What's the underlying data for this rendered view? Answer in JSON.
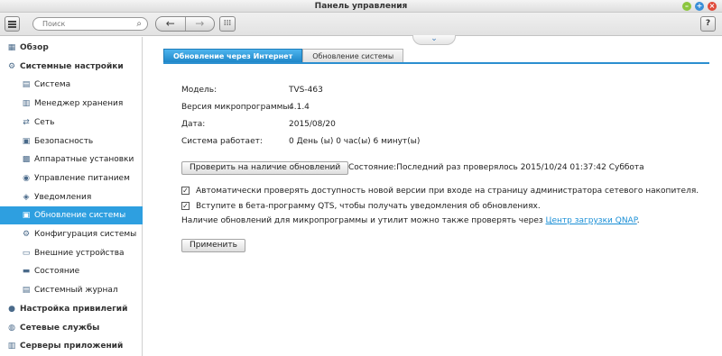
{
  "window": {
    "title": "Панель управления"
  },
  "toolbar": {
    "search_placeholder": "Поиск",
    "help_label": "?"
  },
  "sidebar": {
    "items": [
      {
        "label": "Обзор",
        "kind": "cat",
        "icon": "overview-icon"
      },
      {
        "label": "Системные настройки",
        "kind": "cat",
        "icon": "gear-icon"
      },
      {
        "label": "Система",
        "kind": "sub",
        "icon": "system-icon"
      },
      {
        "label": "Менеджер хранения",
        "kind": "sub",
        "icon": "storage-icon"
      },
      {
        "label": "Сеть",
        "kind": "sub",
        "icon": "network-icon"
      },
      {
        "label": "Безопасность",
        "kind": "sub",
        "icon": "lock-icon"
      },
      {
        "label": "Аппаратные установки",
        "kind": "sub",
        "icon": "hardware-icon"
      },
      {
        "label": "Управление питанием",
        "kind": "sub",
        "icon": "power-icon"
      },
      {
        "label": "Уведомления",
        "kind": "sub",
        "icon": "notification-icon"
      },
      {
        "label": "Обновление системы",
        "kind": "sub",
        "icon": "update-icon",
        "active": true
      },
      {
        "label": "Конфигурация системы",
        "kind": "sub",
        "icon": "config-icon"
      },
      {
        "label": "Внешние устройства",
        "kind": "sub",
        "icon": "external-device-icon"
      },
      {
        "label": "Состояние",
        "kind": "sub",
        "icon": "status-icon"
      },
      {
        "label": "Системный журнал",
        "kind": "sub",
        "icon": "log-icon"
      },
      {
        "label": "Настройка привилегий",
        "kind": "cat",
        "icon": "user-icon"
      },
      {
        "label": "Сетевые службы",
        "kind": "cat",
        "icon": "globe-icon"
      },
      {
        "label": "Серверы приложений",
        "kind": "cat",
        "icon": "server-icon"
      }
    ]
  },
  "tabs": [
    {
      "label": "Обновление через Интернет",
      "active": true
    },
    {
      "label": "Обновление системы",
      "active": false
    }
  ],
  "info": {
    "model_label": "Модель:",
    "model_value": "TVS-463",
    "firmware_label": "Версия микропрограммы:",
    "firmware_value": "4.1.4",
    "date_label": "Дата:",
    "date_value": "2015/08/20",
    "uptime_label": "Система работает:",
    "uptime_value": "0 День (ы) 0 час(ы) 6 минут(ы)"
  },
  "check_button": "Проверить на наличие обновлений",
  "status_text": "Состояние:Последний раз проверялось 2015/10/24 01:37:42 Суббота",
  "options": {
    "auto_check_label": "Автоматически проверять доступность новой версии при входе на страницу администратора сетевого накопителя.",
    "auto_check_checked": true,
    "beta_label": "Вступите в бета-программу QTS, чтобы получать уведомления об обновлениях.",
    "beta_checked": true
  },
  "note": {
    "text": "Наличие обновлений для микропрограммы и утилит можно также проверять через ",
    "link": "Центр загрузки QNAP",
    "suffix": "."
  },
  "apply_button": "Применить",
  "colors": {
    "accent": "#2e9fe0",
    "link": "#1a8fd6"
  }
}
